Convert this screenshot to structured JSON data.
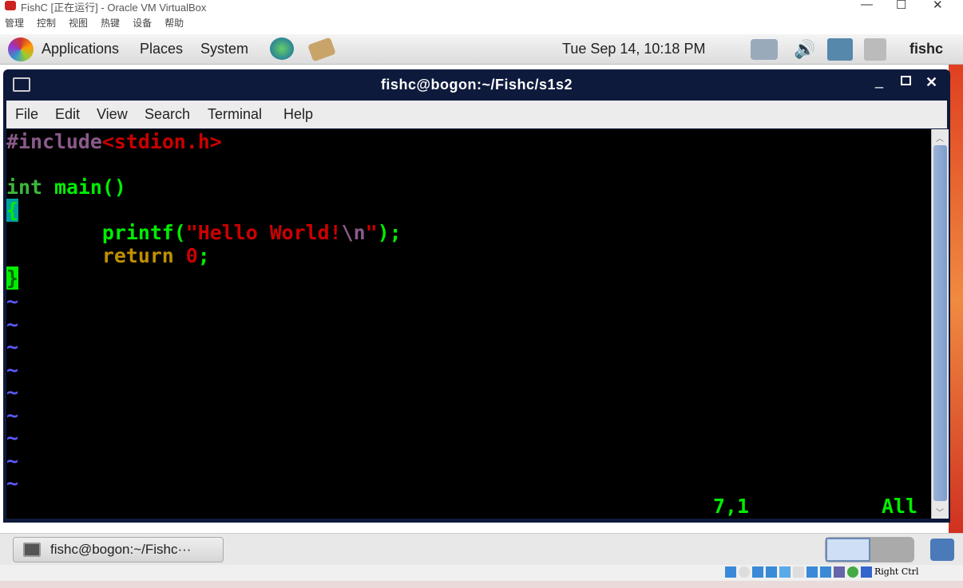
{
  "vbox": {
    "title": "FishC [正在运行] - Oracle VM VirtualBox",
    "menu": [
      "管理",
      "控制",
      "视图",
      "热键",
      "设备",
      "帮助"
    ],
    "host_key": "Right Ctrl"
  },
  "panel": {
    "menus": [
      "Applications",
      "Places",
      "System"
    ],
    "clock": "Tue Sep 14, 10:18 PM",
    "user": "fishc"
  },
  "terminal": {
    "title": "fishc@bogon:~/Fishc/s1s2",
    "menu": [
      "File",
      "Edit",
      "View",
      "Search",
      "Terminal",
      "Help"
    ],
    "code": {
      "l1a": "#include",
      "l1b": "<stdion.h>",
      "l3a": "int",
      "l3b": " main()",
      "l4": "{",
      "l5a": "        printf(",
      "l5b": "\"Hello World!",
      "l5c": "\\n",
      "l5d": "\"",
      "l5e": ");",
      "l6a": "        return",
      "l6b": " 0",
      "l6c": ";",
      "l7": "}",
      "tilde": "~"
    },
    "status_pos": "7,1",
    "status_all": "All"
  },
  "taskbar": {
    "item": "fishc@bogon:~/Fishc···"
  },
  "colors": {
    "preproc": "#8a5a8a",
    "string": "#cc0000",
    "green": "#00ee00",
    "keyword": "#c09000",
    "cursor_bg": "#00a0a0"
  }
}
